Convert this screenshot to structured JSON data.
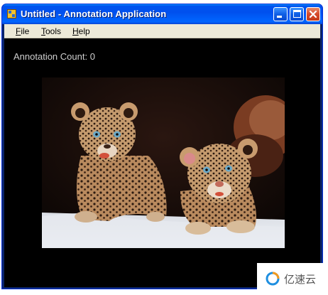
{
  "window": {
    "title": "Untitled - Annotation Application",
    "controls": {
      "minimize": "minimize-icon",
      "maximize": "maximize-icon",
      "close": "close-icon"
    }
  },
  "menu": {
    "items": [
      {
        "accel": "F",
        "rest": "ile"
      },
      {
        "accel": "T",
        "rest": "ools"
      },
      {
        "accel": "H",
        "rest": "elp"
      }
    ]
  },
  "content": {
    "annotation_count_label": "Annotation Count: 0",
    "image_subject": "two leopard cubs"
  },
  "watermark": {
    "text": "亿速云",
    "icon": "yisu-logo-icon"
  },
  "colors": {
    "titlebar": "#0053ee",
    "menubar": "#ece9d8",
    "client_background": "#000000",
    "count_text": "#cfcfcf",
    "close_button": "#d6492a"
  }
}
